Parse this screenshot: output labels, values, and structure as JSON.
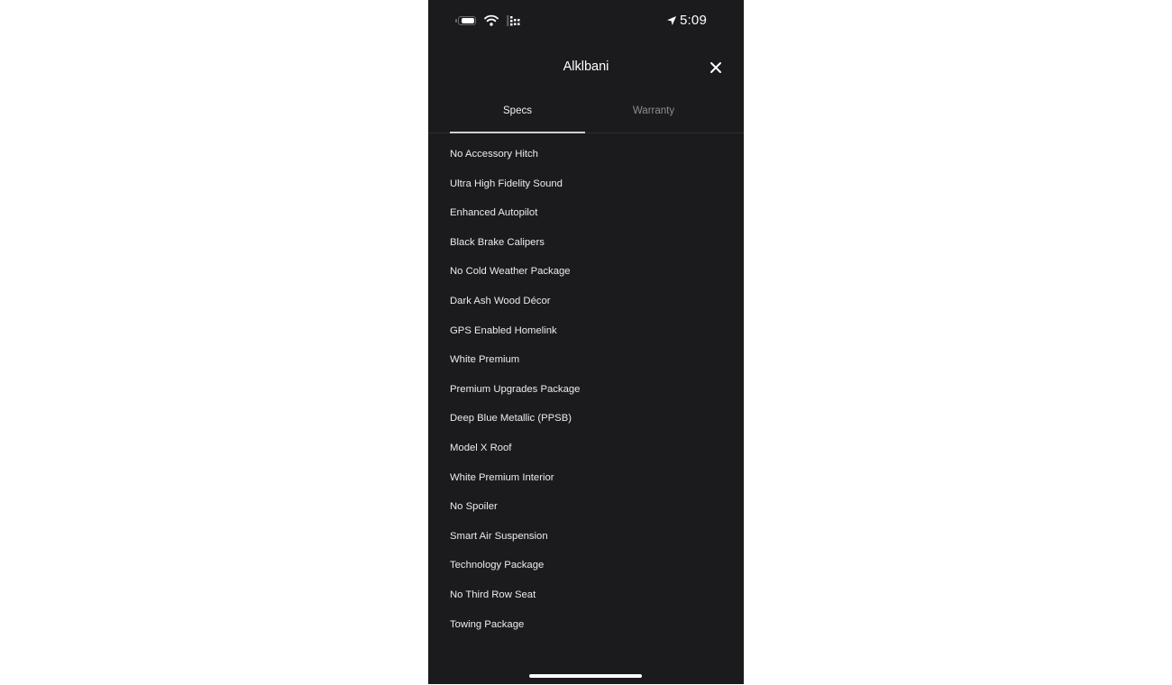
{
  "status_bar": {
    "time": "5:09",
    "icons": [
      "battery-icon",
      "wifi-icon",
      "cellular-signal-icon",
      "location-arrow-icon"
    ]
  },
  "header": {
    "title": "Alklbani",
    "close_icon": "close-icon"
  },
  "tabs": [
    {
      "label": "Specs",
      "active": true
    },
    {
      "label": "Warranty",
      "active": false
    }
  ],
  "specs": [
    "No Accessory Hitch",
    "Ultra High Fidelity Sound",
    "Enhanced Autopilot",
    "Black Brake Calipers",
    "No Cold Weather Package",
    "Dark Ash Wood Décor",
    "GPS Enabled Homelink",
    "White Premium",
    "Premium Upgrades Package",
    "Deep Blue Metallic (PPSB)",
    "Model X Roof",
    "White Premium Interior",
    "No Spoiler",
    "Smart Air Suspension",
    "Technology Package",
    "No Third Row Seat",
    "Towing Package"
  ],
  "colors": {
    "background": "#1b1b1d",
    "text": "#ececec",
    "inactive_tab": "#8d8d8f",
    "tab_indicator": "#d0d0d0"
  }
}
